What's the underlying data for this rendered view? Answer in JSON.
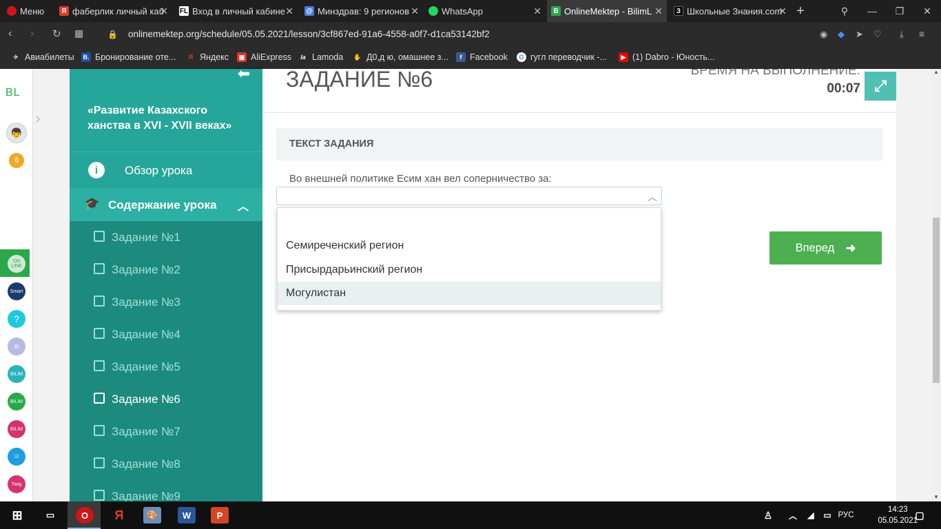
{
  "browser": {
    "menu_label": "Меню",
    "tabs": [
      {
        "title": "фаберлик личный каб",
        "icon": "yandex-icon",
        "color": "#e03a2f"
      },
      {
        "title": "Вход в личный кабине",
        "icon": "faberlic-icon",
        "color": "#ffffff"
      },
      {
        "title": "Минздрав: 9 регионов",
        "icon": "mail-icon",
        "color": "#4a78d6"
      },
      {
        "title": "WhatsApp",
        "icon": "whatsapp-icon",
        "color": "#25d366"
      },
      {
        "title": "OnlineMektep - BilimL",
        "icon": "bilimland-icon",
        "color": "#2aa84a"
      },
      {
        "title": "Школьные Знания.com",
        "icon": "znanija-icon",
        "color": "#000000"
      }
    ],
    "url": "onlinemektep.org/schedule/05.05.2021/lesson/3cf867ed-91a6-4558-a0f7-d1ca53142bf2",
    "bookmarks": [
      {
        "label": "Авиабилеты",
        "icon": "plane-icon"
      },
      {
        "label": "Бронирование оте...",
        "icon": "booking-icon"
      },
      {
        "label": "Яндекс",
        "icon": "yandex-icon"
      },
      {
        "label": "AliExpress",
        "icon": "aliexpress-icon"
      },
      {
        "label": "Lamoda",
        "icon": "lamoda-icon"
      },
      {
        "label": "Д0,д ю, омашнее з...",
        "icon": "hand-icon"
      },
      {
        "label": "Facebook",
        "icon": "facebook-icon"
      },
      {
        "label": "гугл переводчик -...",
        "icon": "google-icon"
      },
      {
        "label": "(1) Dabro - Юность...",
        "icon": "youtube-icon"
      }
    ]
  },
  "opera_sidebar": {
    "badge_count": "6"
  },
  "lesson": {
    "title": "«Развитие Казахского ханства в XVI - XVII веках»",
    "overview_label": "Обзор урока",
    "content_label": "Содержание урока",
    "tasks": [
      "Задание №1",
      "Задание №2",
      "Задание №3",
      "Задание №4",
      "Задание №5",
      "Задание №6",
      "Задание №7",
      "Задание №8",
      "Задание №9"
    ],
    "active_task_index": 5
  },
  "main": {
    "task_title": "ЗАДАНИЕ №6",
    "time_label": "ВРЕМЯ НА ВЫПОЛНЕНИЕ:",
    "time_value": "00:07",
    "task_text_label": "ТЕКСТ ЗАДАНИЯ",
    "question": "Во внешней политике Есим хан вел соперничество за:",
    "select_value": "",
    "options": [
      "",
      "Семиреченский регион",
      "Присырдарьинский регион",
      "Могулистан"
    ],
    "highlighted_option_index": 3,
    "next_label": "Вперед"
  },
  "taskbar": {
    "lang": "РУС",
    "time": "14:23",
    "date": "05.05.2021"
  }
}
